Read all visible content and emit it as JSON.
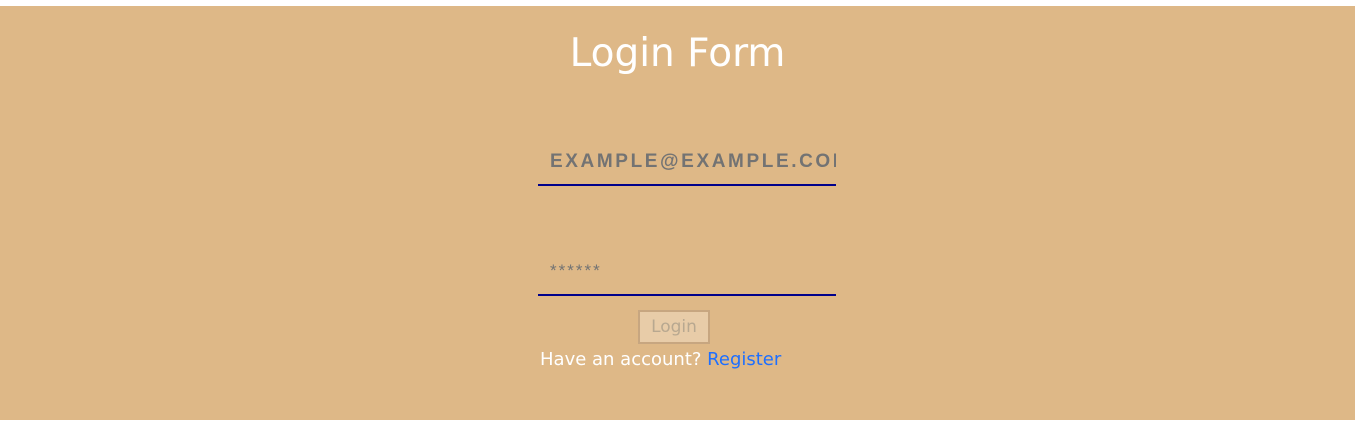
{
  "form": {
    "title": "Login Form",
    "email_placeholder": "EXAMPLE@EXAMPLE.COM",
    "password_placeholder": "******",
    "login_label": "Login",
    "account_prompt": "Have an account?",
    "register_label": "Register"
  },
  "colors": {
    "background": "#deb887",
    "underline": "#00008b",
    "link": "#1e6fff",
    "title": "#ffffff"
  }
}
